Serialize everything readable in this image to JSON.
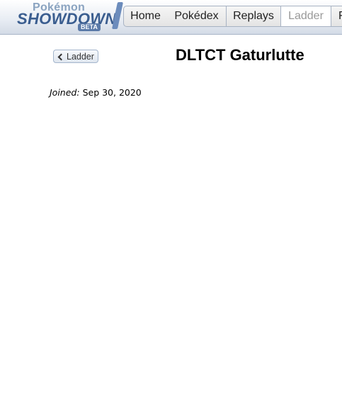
{
  "logo": {
    "top": "Pokémon",
    "main": "SHOWDOWN",
    "badge": "BETA"
  },
  "nav": {
    "tabs": [
      {
        "label": "Home"
      },
      {
        "label": "Pokédex"
      },
      {
        "label": "Replays"
      },
      {
        "label": "Ladder",
        "current": true
      },
      {
        "label": "F"
      }
    ]
  },
  "page": {
    "back_label": "Ladder",
    "username": "DLTCT Gaturlutte",
    "joined_label": "Joined:",
    "joined_date": "Sep 30, 2020"
  },
  "colors": {
    "brand": "#3a5d8f",
    "inactive_tab_text": "#999999"
  }
}
